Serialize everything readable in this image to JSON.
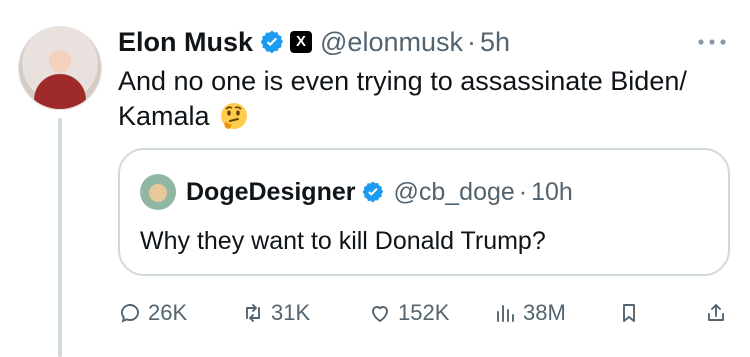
{
  "tweet": {
    "author": {
      "name": "Elon Musk",
      "handle": "@elonmusk",
      "time": "5h",
      "separator": "·"
    },
    "text": "And no one is even trying to assassinate Biden/ Kamala",
    "emoji": "thinking-face",
    "quote": {
      "author": {
        "name": "DogeDesigner",
        "handle": "@cb_doge",
        "time": "10h",
        "separator": "·"
      },
      "text": "Why they want to kill Donald Trump?"
    },
    "actions": {
      "replies": "26K",
      "reposts": "31K",
      "likes": "152K",
      "views": "38M"
    }
  },
  "colors": {
    "verified": "#1d9bf0",
    "muted": "#536471",
    "border": "#cfd9de"
  }
}
